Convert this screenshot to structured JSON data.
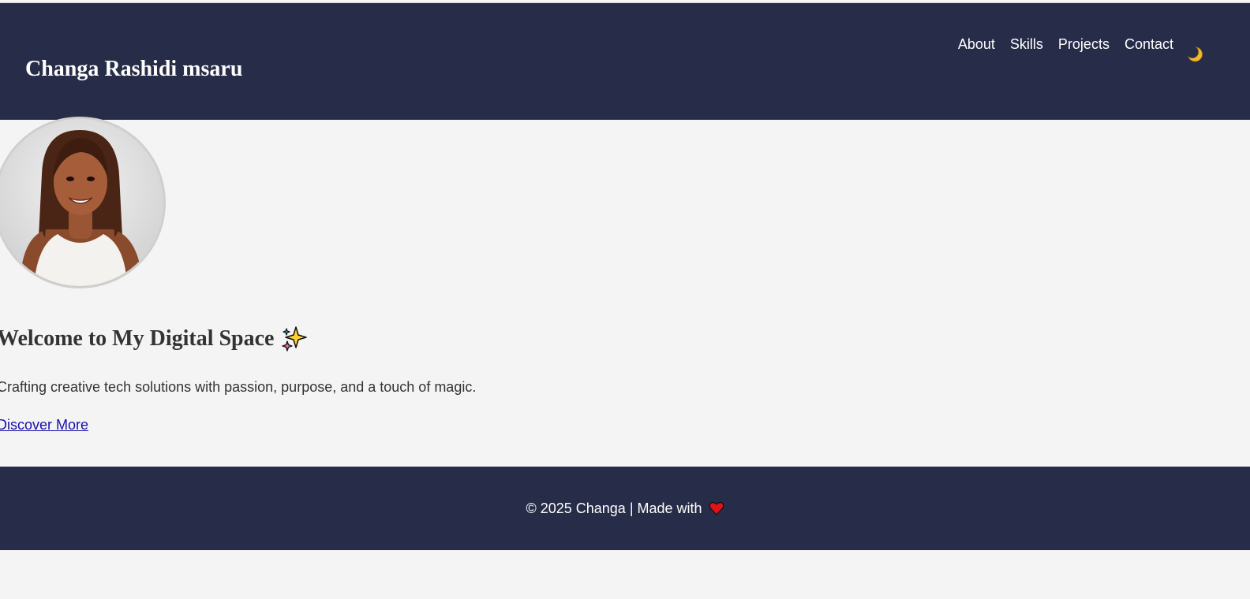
{
  "header": {
    "site_title": "Changa Rashidi msaru",
    "nav": [
      {
        "label": "About"
      },
      {
        "label": "Skills"
      },
      {
        "label": "Projects"
      },
      {
        "label": "Contact"
      }
    ],
    "theme_toggle_icon": "crescent-moon-icon"
  },
  "hero": {
    "avatar": "profile-photo",
    "title": "Welcome to My Digital Space",
    "title_icon": "sparkles-icon",
    "subtitle": "Crafting creative tech solutions with passion, purpose, and a touch of magic.",
    "cta_label": "Discover More"
  },
  "footer": {
    "text": "© 2025 Changa | Made with",
    "icon": "heart-icon"
  },
  "colors": {
    "header_bg": "#272d48",
    "page_bg": "#f4f4f4",
    "link": "#1a0dab",
    "heart": "#e0131b",
    "moon": "#f5b731"
  }
}
